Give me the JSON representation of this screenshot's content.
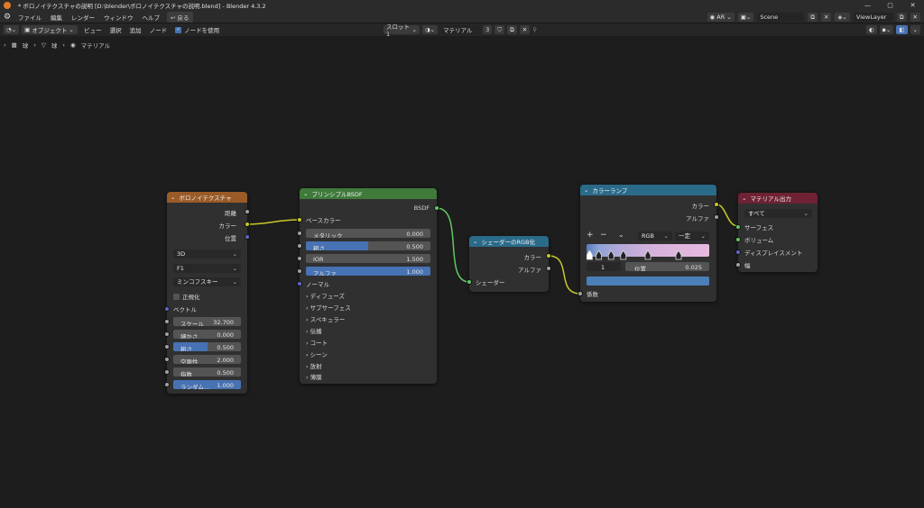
{
  "titlebar": {
    "title": "* ボロノイテクスチャの説明 [D:\\blender\\ボロノイテクスチャの説明.blend] - Blender 4.3.2",
    "min": "—",
    "max": "▢",
    "close": "✕"
  },
  "menubar": {
    "items": [
      "ファイル",
      "編集",
      "レンダー",
      "ウィンドウ",
      "ヘルプ"
    ],
    "back_button": "戻る",
    "ar": "AR",
    "scene": "Scene",
    "view_layer": "ViewLayer"
  },
  "editor_header": {
    "mode": "オブジェクト",
    "view": "ビュー",
    "select": "選択",
    "add": "追加",
    "node": "ノード",
    "use_nodes": "ノードを使用",
    "slot": "スロット1",
    "material": "マテリアル",
    "users": "3"
  },
  "breadcrumb": [
    "球",
    "球",
    "マテリアル"
  ],
  "voronoi": {
    "title": "ボロノイテクスチャ",
    "outputs": [
      "距離",
      "カラー",
      "位置"
    ],
    "dimension": "3D",
    "feature": "F1",
    "metric": "ミンコフスキー",
    "normalize": "正規化",
    "vector": "ベクトル",
    "fields": [
      {
        "label": "スケール",
        "value": "32.700",
        "fill": 0
      },
      {
        "label": "細かさ",
        "value": "0.000",
        "fill": 0
      },
      {
        "label": "粗さ",
        "value": "0.500",
        "fill": 0.5
      },
      {
        "label": "空隙性",
        "value": "2.000",
        "fill": 0
      },
      {
        "label": "指数",
        "value": "0.500",
        "fill": 0
      },
      {
        "label": "ランダム...",
        "value": "1.000",
        "fill": 1
      }
    ]
  },
  "principled": {
    "title": "プリンシプルBSDF",
    "output": "BSDF",
    "base_color": "ベースカラー",
    "fields": [
      {
        "label": "メタリック",
        "value": "0.000",
        "fill": 0
      },
      {
        "label": "粗さ",
        "value": "0.500",
        "fill": 0.5
      },
      {
        "label": "IOR",
        "value": "1.500",
        "fill": 0
      },
      {
        "label": "アルファ",
        "value": "1.000",
        "fill": 1
      }
    ],
    "normal": "ノーマル",
    "panels": [
      "ディフューズ",
      "サブサーフェス",
      "スペキュラー",
      "伝播",
      "コート",
      "シーン",
      "放射",
      "薄膜"
    ]
  },
  "shader_rgb": {
    "title": "シェーダーのRGB化",
    "outputs": [
      "カラー",
      "アルファ"
    ],
    "input": "シェーダー"
  },
  "color_ramp": {
    "title": "カラーランプ",
    "outputs": [
      "カラー",
      "アルファ"
    ],
    "add": "+",
    "remove": "−",
    "color_mode": "RGB",
    "interpolation": "一定",
    "index": "1",
    "position_label": "位置",
    "position_value": "0.025",
    "input": "係数",
    "stop_positions": [
      0.025,
      0.1,
      0.2,
      0.3,
      0.5,
      0.75
    ]
  },
  "material_output": {
    "title": "マテリアル出力",
    "target": "すべて",
    "inputs": [
      "サーフェス",
      "ボリューム",
      "ディスプレイスメント",
      "幅"
    ]
  }
}
